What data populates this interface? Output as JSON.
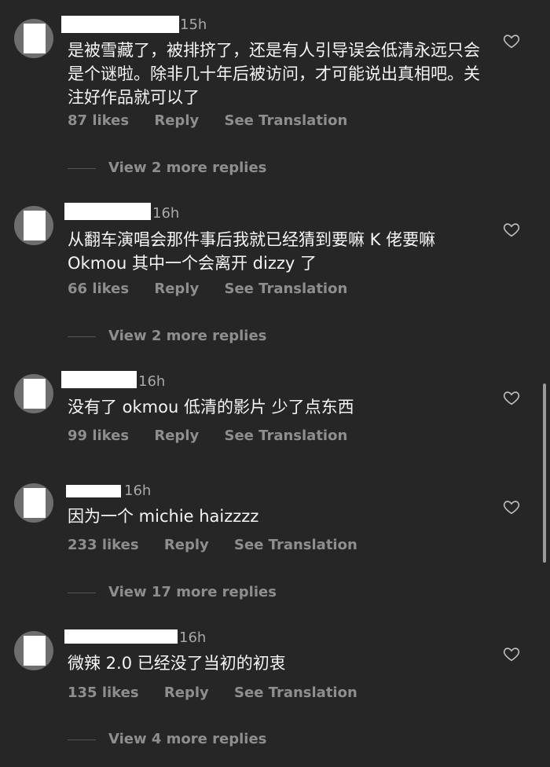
{
  "comments": [
    {
      "time": "15h",
      "text": "是被雪藏了，被排挤了，还是有人引导误会低清永远只会是个谜啦。除非几十年后被访问，才可能说出真相吧。关注好作品就可以了",
      "likes": "87 likes",
      "reply": "Reply",
      "translate": "See Translation",
      "more": "View 2 more replies"
    },
    {
      "time": "16h",
      "text": "从翻车演唱会那件事后我就已经猜到要嘛 K 佬要嘛 Okmou 其中一个会离开 dizzy 了",
      "likes": "66 likes",
      "reply": "Reply",
      "translate": "See Translation",
      "more": "View 2 more replies"
    },
    {
      "time": "16h",
      "text": "没有了 okmou 低清的影片 少了点东西",
      "likes": "99 likes",
      "reply": "Reply",
      "translate": "See Translation",
      "more": ""
    },
    {
      "time": "16h",
      "text": "因为一个 michie haizzzz",
      "likes": "233 likes",
      "reply": "Reply",
      "translate": "See Translation",
      "more": "View 17 more replies"
    },
    {
      "time": "16h",
      "text": "微辣 2.0  已经没了当初的初衷",
      "likes": "135 likes",
      "reply": "Reply",
      "translate": "See Translation",
      "more": "View 4 more replies"
    }
  ],
  "icons": {
    "heart": "heart-outline-icon"
  },
  "colors": {
    "background": "#262626",
    "primary_text": "#f5f5f5",
    "secondary_text": "#8e8e8e"
  }
}
